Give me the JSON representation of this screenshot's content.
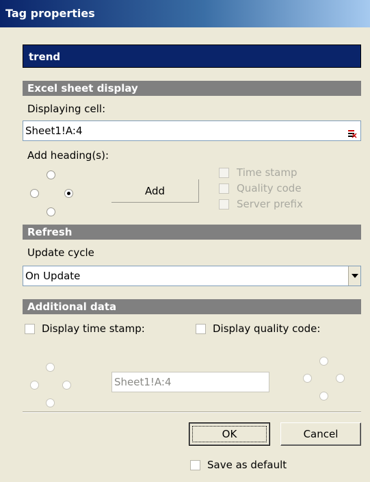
{
  "window": {
    "title": "Tag properties"
  },
  "tag": {
    "name": "trend"
  },
  "excel_section": {
    "header": "Excel sheet display",
    "displaying_cell_label": "Displaying cell:",
    "displaying_cell_value": "Sheet1!A:4",
    "add_headings_label": "Add heading(s):",
    "add_button": "Add",
    "heading_options": [
      "Time stamp",
      "Quality code",
      "Server prefix"
    ]
  },
  "refresh_section": {
    "header": "Refresh",
    "update_cycle_label": "Update cycle",
    "update_cycle_value": "On Update"
  },
  "additional_section": {
    "header": "Additional data",
    "display_time_stamp": "Display time stamp:",
    "display_quality_code": "Display quality code:",
    "cell_value": "Sheet1!A:4"
  },
  "buttons": {
    "ok": "OK",
    "cancel": "Cancel"
  },
  "save_as_default": "Save as default"
}
